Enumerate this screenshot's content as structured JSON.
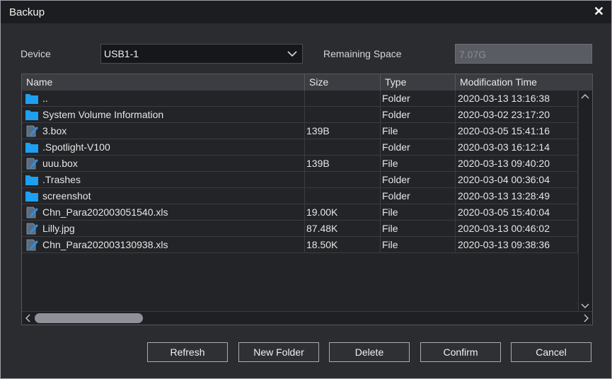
{
  "window": {
    "title": "Backup"
  },
  "device": {
    "label": "Device",
    "selected": "USB1-1"
  },
  "remaining": {
    "label": "Remaining Space",
    "value": "7.07G"
  },
  "table": {
    "columns": [
      "Name",
      "Size",
      "Type",
      "Modification Time"
    ],
    "rows": [
      {
        "icon": "folder-icon",
        "name": "..",
        "size": "",
        "type": "Folder",
        "time": "2020-03-13 13:16:38"
      },
      {
        "icon": "folder-icon",
        "name": "System Volume Information",
        "size": "",
        "type": "Folder",
        "time": "2020-03-02 23:17:20"
      },
      {
        "icon": "file-icon",
        "name": "3.box",
        "size": "139B",
        "type": "File",
        "time": "2020-03-05 15:41:16"
      },
      {
        "icon": "folder-icon",
        "name": ".Spotlight-V100",
        "size": "",
        "type": "Folder",
        "time": "2020-03-03 16:12:14"
      },
      {
        "icon": "file-icon",
        "name": "uuu.box",
        "size": "139B",
        "type": "File",
        "time": "2020-03-13 09:40:20"
      },
      {
        "icon": "folder-icon",
        "name": ".Trashes",
        "size": "",
        "type": "Folder",
        "time": "2020-03-04 00:36:04"
      },
      {
        "icon": "folder-icon",
        "name": "screenshot",
        "size": "",
        "type": "Folder",
        "time": "2020-03-13 13:28:49"
      },
      {
        "icon": "file-icon",
        "name": "Chn_Para202003051540.xls",
        "size": "19.00K",
        "type": "File",
        "time": "2020-03-05 15:40:04"
      },
      {
        "icon": "file-icon",
        "name": "Lilly.jpg",
        "size": "87.48K",
        "type": "File",
        "time": "2020-03-13 00:46:02"
      },
      {
        "icon": "file-icon",
        "name": "Chn_Para202003130938.xls",
        "size": "18.50K",
        "type": "File",
        "time": "2020-03-13 09:38:36"
      }
    ]
  },
  "buttons": {
    "refresh": "Refresh",
    "new_folder": "New Folder",
    "delete": "Delete",
    "confirm": "Confirm",
    "cancel": "Cancel"
  },
  "colors": {
    "folder": "#1ea0f0",
    "file_body": "#5a6c80",
    "file_pencil": "#2f8fe0"
  }
}
